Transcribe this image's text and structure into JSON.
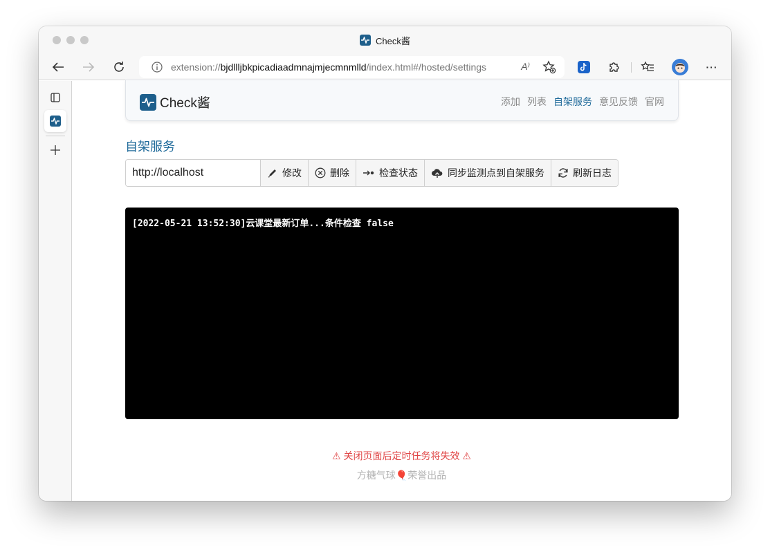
{
  "window": {
    "title": "Check酱"
  },
  "browser": {
    "url_prefix": "extension://",
    "url_host": "bjdllljbkpicadiaadmnajmjecmnmlld",
    "url_path": "/index.html#/hosted/settings",
    "read_aloud_label": "A⁾",
    "more_label": "···"
  },
  "app": {
    "brand": "Check酱",
    "nav": [
      "添加",
      "列表",
      "自架服务",
      "意见反馈",
      "官网"
    ],
    "active_nav": "自架服务"
  },
  "hosted": {
    "section_title": "自架服务",
    "server_url": "http://localhost",
    "buttons": {
      "edit": "修改",
      "delete": "删除",
      "check": "检查状态",
      "sync": "同步监测点到自架服务",
      "refresh": "刷新日志"
    },
    "log_lines": [
      "[2022-05-21 13:52:30]云课堂最新订单...条件检查 false"
    ]
  },
  "footer": {
    "warning": "⚠ 关闭页面后定时任务将失效 ⚠",
    "credit_pre": "方糖气球",
    "credit_emoji": "🎈",
    "credit_post": "荣誉出品"
  },
  "colors": {
    "accent": "#1f6a9a",
    "warning": "#e04646",
    "terminal_bg": "#000000"
  }
}
